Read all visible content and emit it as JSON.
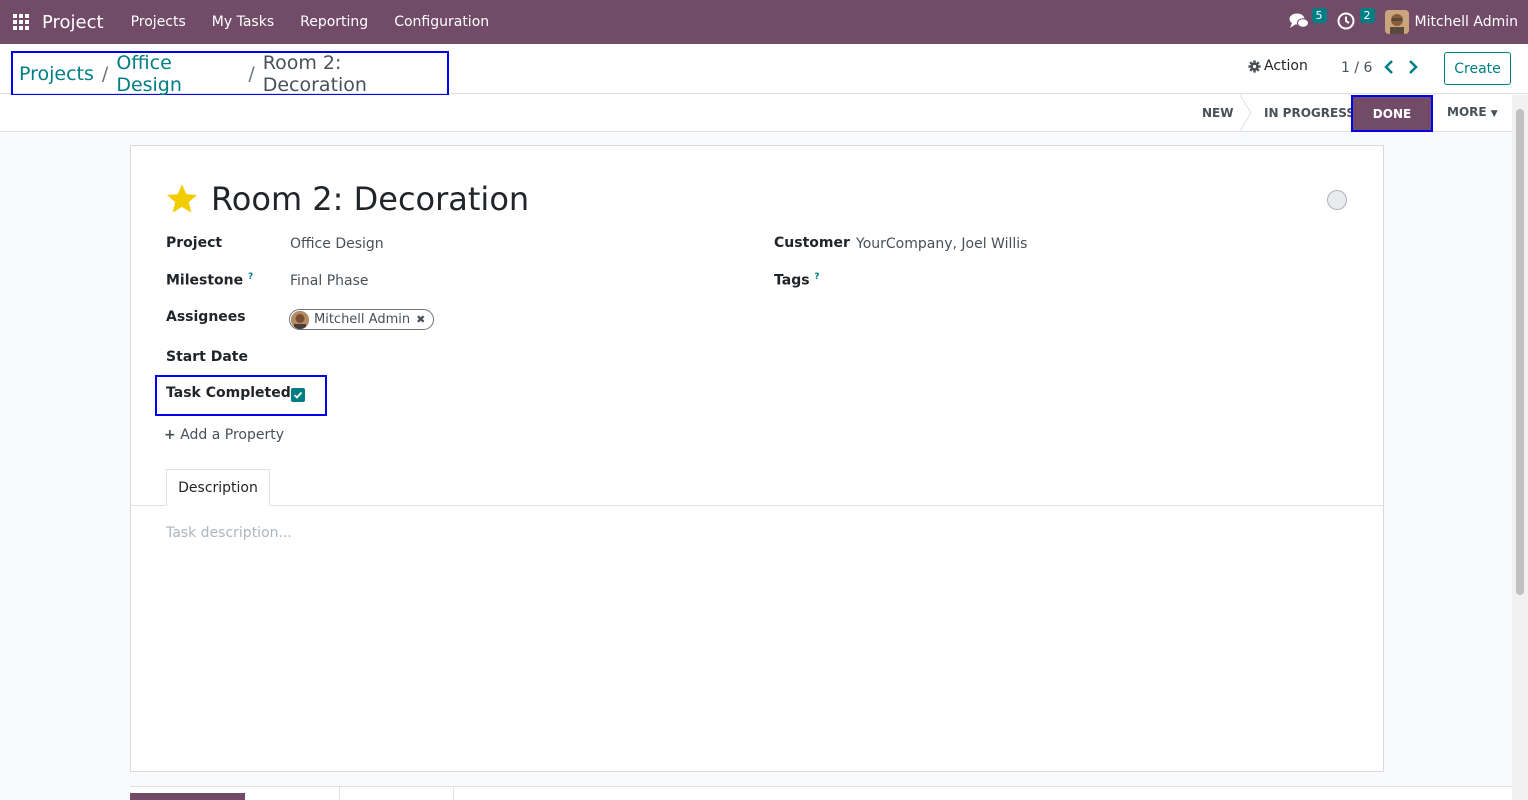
{
  "navbar": {
    "brand": "Project",
    "menu": [
      "Projects",
      "My Tasks",
      "Reporting",
      "Configuration"
    ],
    "messages_count": "5",
    "activities_count": "2",
    "user": "Mitchell Admin",
    "bg_color": "#714b67"
  },
  "breadcrumb": {
    "items": [
      "Projects",
      "Office Design"
    ],
    "current": "Room 2: Decoration"
  },
  "control": {
    "action_label": "Action",
    "pager": "1 / 6",
    "create_label": "Create"
  },
  "statusbar": {
    "stages": [
      "NEW",
      "IN PROGRESS",
      "DONE"
    ],
    "active_stage": "DONE",
    "more_label": "MORE"
  },
  "task": {
    "title": "Room 2: Decoration",
    "starred": true,
    "fields": {
      "project_label": "Project",
      "project_value": "Office Design",
      "milestone_label": "Milestone",
      "milestone_value": "Final Phase",
      "assignees_label": "Assignees",
      "assignee": "Mitchell Admin",
      "start_date_label": "Start Date",
      "task_completed_label": "Task Completed",
      "task_completed": true,
      "customer_label": "Customer",
      "customer_value": "YourCompany, Joel Willis",
      "tags_label": "Tags",
      "help_mark": "?"
    },
    "add_property_label": "Add a Property",
    "tab_description": "Description",
    "description_placeholder": "Task description..."
  },
  "colors": {
    "accent": "#017e84",
    "brand": "#714b67",
    "star": "#f3cc00",
    "highlight": "#0000ee"
  }
}
